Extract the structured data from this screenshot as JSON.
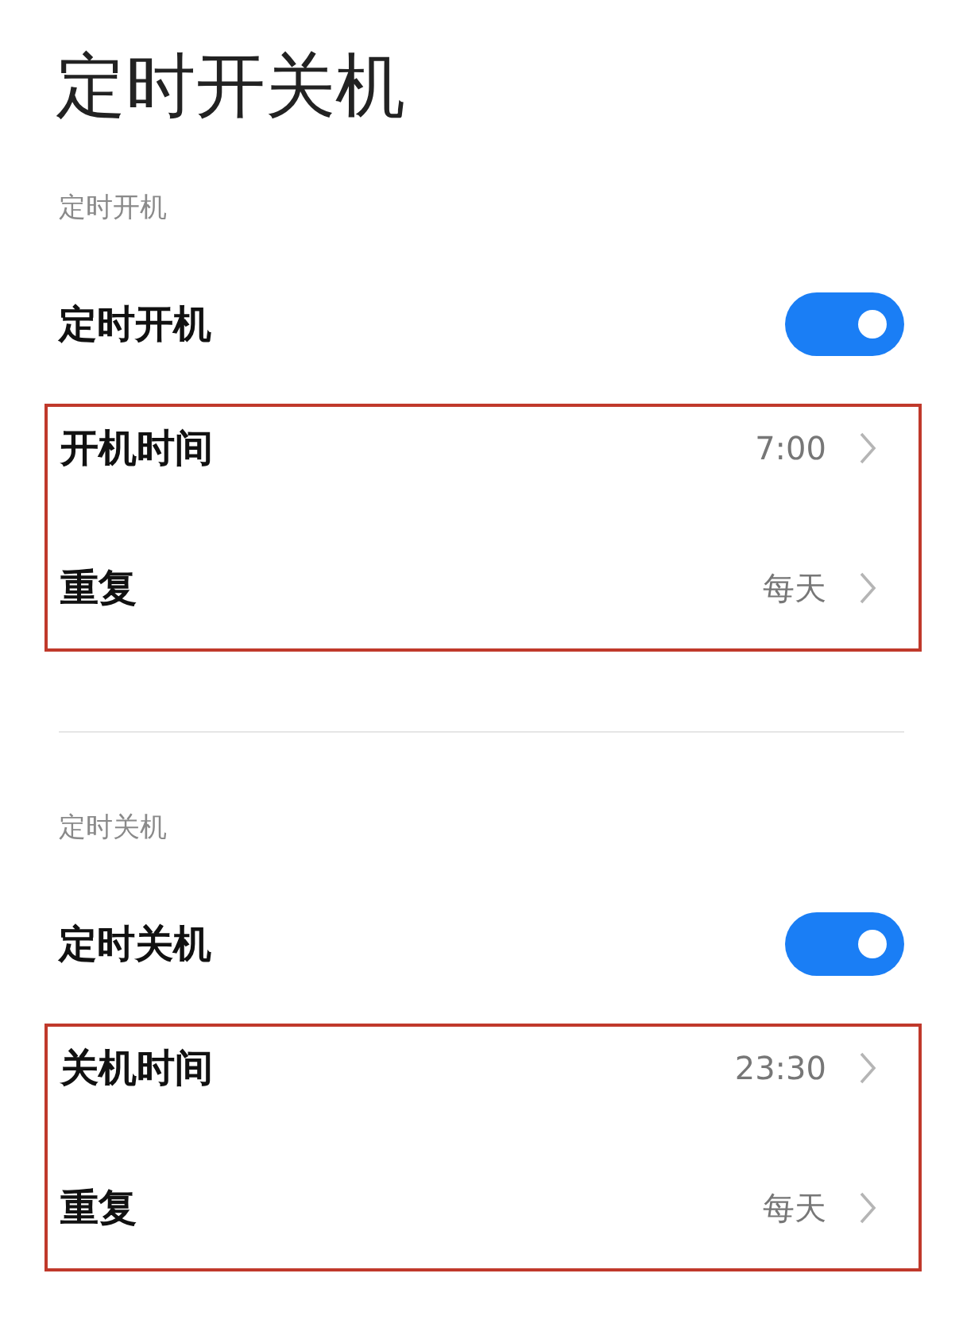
{
  "title": "定时开关机",
  "sections": [
    {
      "header": "定时开机",
      "toggle": {
        "label": "定时开机",
        "on": true
      },
      "highlighted": true,
      "rows": [
        {
          "label": "开机时间",
          "value": "7:00"
        },
        {
          "label": "重复",
          "value": "每天"
        }
      ]
    },
    {
      "header": "定时关机",
      "toggle": {
        "label": "定时关机",
        "on": true
      },
      "highlighted": true,
      "rows": [
        {
          "label": "关机时间",
          "value": "23:30"
        },
        {
          "label": "重复",
          "value": "每天"
        }
      ]
    }
  ]
}
